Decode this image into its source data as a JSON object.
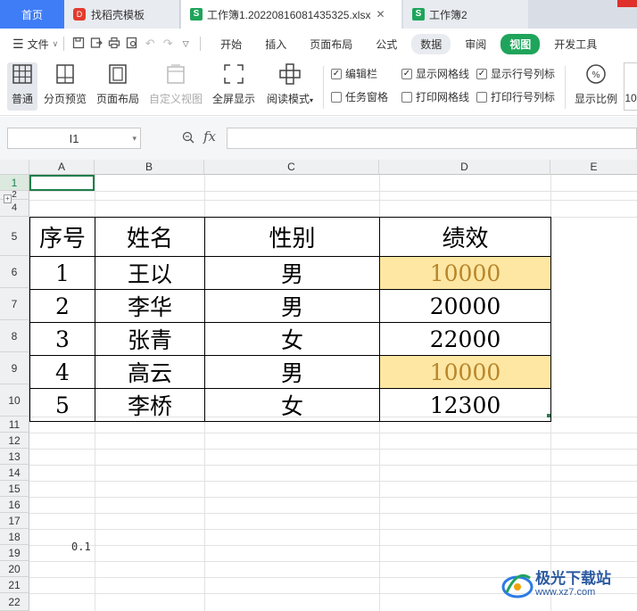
{
  "tabs": {
    "home": "首页",
    "template": "找稻壳模板",
    "workbook1": "工作簿1.20220816081435325.xlsx",
    "workbook2": "工作簿2",
    "add": "+"
  },
  "menubar": {
    "file": "文件",
    "items": [
      "开始",
      "插入",
      "页面布局",
      "公式",
      "数据",
      "审阅",
      "视图",
      "开发工具"
    ]
  },
  "ribbon": {
    "buttons": [
      "普通",
      "分页预览",
      "页面布局",
      "自定义视图",
      "全屏显示",
      "阅读模式",
      "显示比例",
      "10"
    ],
    "checks": [
      {
        "label": "编辑栏",
        "checked": true
      },
      {
        "label": "显示网格线",
        "checked": true
      },
      {
        "label": "显示行号列标",
        "checked": true
      },
      {
        "label": "任务窗格",
        "checked": false
      },
      {
        "label": "打印网格线",
        "checked": false
      },
      {
        "label": "打印行号列标",
        "checked": false
      }
    ]
  },
  "formula_bar": {
    "name_box": "I1",
    "fx": "fx",
    "value": ""
  },
  "columns": [
    "A",
    "B",
    "C",
    "D",
    "E"
  ],
  "rows": [
    "1",
    "2",
    "4",
    "5",
    "6",
    "7",
    "8",
    "9",
    "10",
    "11",
    "12",
    "13",
    "14",
    "15",
    "16",
    "17",
    "18",
    "19",
    "20",
    "21",
    "22"
  ],
  "table": {
    "headers": [
      "序号",
      "姓名",
      "性别",
      "绩效"
    ],
    "rows": [
      {
        "no": "1",
        "name": "王以",
        "gender": "男",
        "perf": "10000",
        "highlight": true
      },
      {
        "no": "2",
        "name": "李华",
        "gender": "男",
        "perf": "20000",
        "highlight": false
      },
      {
        "no": "3",
        "name": "张青",
        "gender": "女",
        "perf": "22000",
        "highlight": false
      },
      {
        "no": "4",
        "name": "高云",
        "gender": "男",
        "perf": "10000",
        "highlight": true
      },
      {
        "no": "5",
        "name": "李桥",
        "gender": "女",
        "perf": "12300",
        "highlight": false
      }
    ]
  },
  "cells": {
    "b18_value": "0.1"
  },
  "colors": {
    "highlight_fill": "#fde7a3",
    "highlight_text": "#b8862c",
    "accent_green": "#1fa45b",
    "home_tab": "#3f7df6"
  },
  "watermark": {
    "title": "极光下载站",
    "url": "www.xz7.com"
  }
}
